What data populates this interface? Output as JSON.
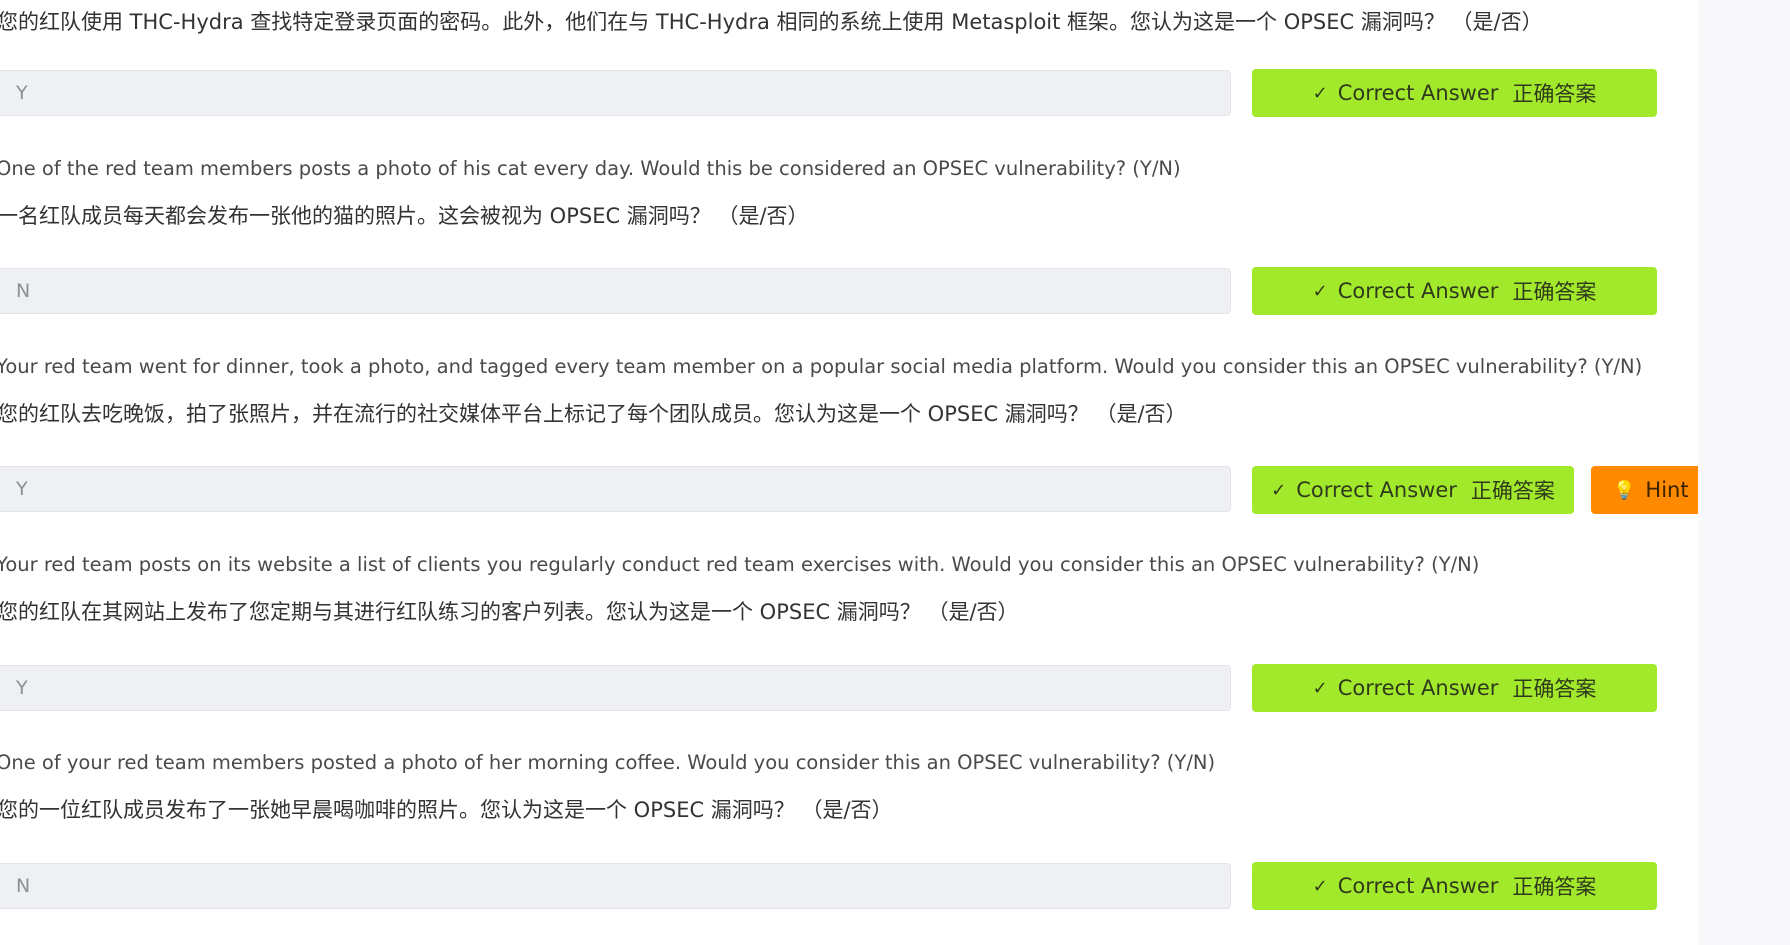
{
  "questions": [
    {
      "english": "",
      "chinese": "您的红队使用 THC-Hydra 查找特定登录页面的密码。此外，他们在与 THC-Hydra 相同的系统上使用 Metasploit 框架。您认为这是一个 OPSEC 漏洞吗？  （是/否）",
      "answer": "Y",
      "correct_label": "Correct Answer",
      "correct_label_zh": "正确答案"
    },
    {
      "english": "One of the red team members posts a photo of his cat every day. Would this be considered an OPSEC vulnerability? (Y/N)",
      "chinese": "一名红队成员每天都会发布一张他的猫的照片。这会被视为 OPSEC 漏洞吗？  （是/否）",
      "answer": "N",
      "correct_label": "Correct Answer",
      "correct_label_zh": "正确答案"
    },
    {
      "english": "Your red team went for dinner, took a photo, and tagged every team member on a popular social media platform. Would you consider this an OPSEC vulnerability? (Y/N)",
      "chinese": "您的红队去吃晚饭，拍了张照片，并在流行的社交媒体平台上标记了每个团队成员。您认为这是一个 OPSEC 漏洞吗？  （是/否）",
      "answer": "Y",
      "correct_label": "Correct Answer",
      "correct_label_zh": "正确答案",
      "hint_label": "Hint"
    },
    {
      "english": "Your red team posts on its website a list of clients you regularly conduct red team exercises with. Would you consider this an OPSEC vulnerability? (Y/N)",
      "chinese": "您的红队在其网站上发布了您定期与其进行红队练习的客户列表。您认为这是一个 OPSEC 漏洞吗？  （是/否）",
      "answer": "Y",
      "correct_label": "Correct Answer",
      "correct_label_zh": "正确答案"
    },
    {
      "english": "One of your red team members posted a photo of her morning coffee. Would you consider this an OPSEC vulnerability? (Y/N)",
      "chinese": "您的一位红队成员发布了一张她早晨喝咖啡的照片。您认为这是一个 OPSEC 漏洞吗？  （是/否）",
      "answer": "N",
      "correct_label": "Correct Answer",
      "correct_label_zh": "正确答案"
    }
  ],
  "icons": {
    "correct": "checkmark-icon",
    "hint": "lightbulb-icon"
  },
  "colors": {
    "correct_button": "#a3e92b",
    "hint_button": "#ff8a00",
    "input_background": "#eef0f4"
  }
}
